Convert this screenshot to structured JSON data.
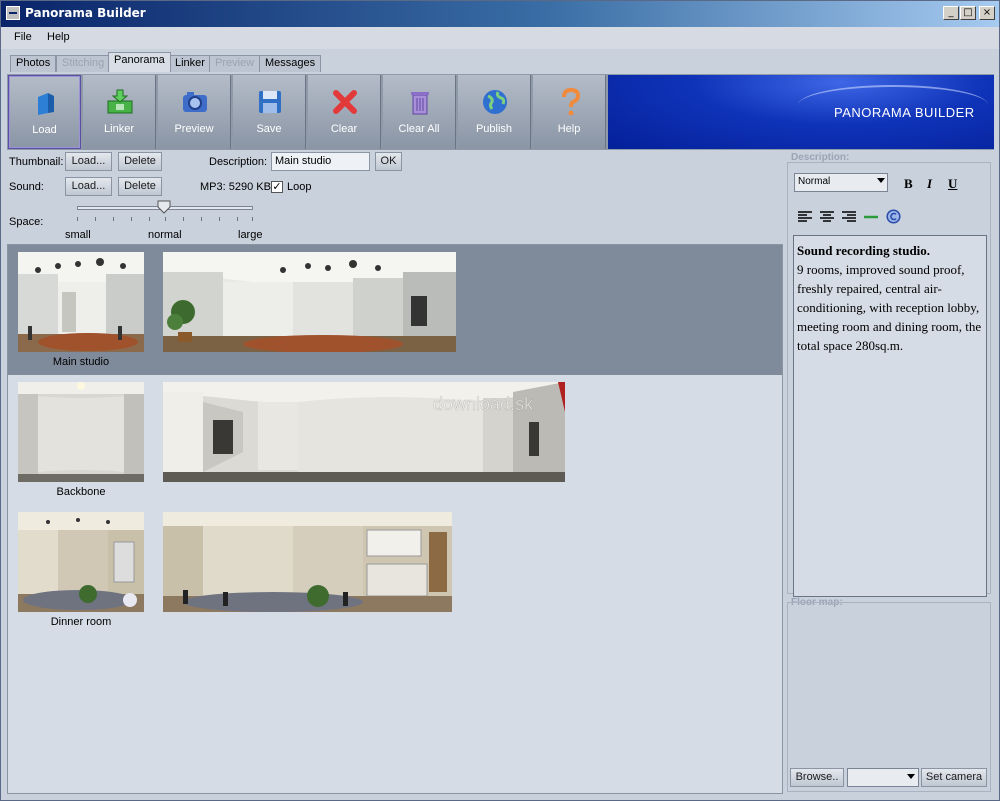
{
  "window": {
    "title": "Panorama Builder",
    "controls": {
      "minimize": "_",
      "maximize": "□",
      "close": "×"
    }
  },
  "menu": {
    "items": [
      "File",
      "Help"
    ]
  },
  "tabs": [
    {
      "label": "Photos",
      "state": "normal"
    },
    {
      "label": "Stitching",
      "state": "disabled"
    },
    {
      "label": "Panorama",
      "state": "active"
    },
    {
      "label": "Linker",
      "state": "normal"
    },
    {
      "label": "Preview",
      "state": "disabled"
    },
    {
      "label": "Messages",
      "state": "normal"
    }
  ],
  "toolbar": {
    "buttons": [
      {
        "label": "Load",
        "icon": "load-icon"
      },
      {
        "label": "Linker",
        "icon": "linker-icon"
      },
      {
        "label": "Preview",
        "icon": "camera-icon"
      },
      {
        "label": "Save",
        "icon": "save-icon"
      },
      {
        "label": "Clear",
        "icon": "clear-icon"
      },
      {
        "label": "Clear All",
        "icon": "trash-icon"
      },
      {
        "label": "Publish",
        "icon": "globe-icon"
      },
      {
        "label": "Help",
        "icon": "help-icon"
      }
    ],
    "banner_text": "PANORAMA BUILDER"
  },
  "properties": {
    "thumbnail_label": "Thumbnail:",
    "load_label": "Load...",
    "delete_label": "Delete",
    "description_label": "Description:",
    "description_value": "Main studio",
    "ok_label": "OK",
    "sound_label": "Sound:",
    "mp3_info": "MP3: 5290 KB",
    "loop_label": "Loop",
    "loop_checked": "✓",
    "space_label": "Space:",
    "space_small": "small",
    "space_normal": "normal",
    "space_large": "large"
  },
  "panoramas": [
    {
      "name": "Main studio",
      "selected": true
    },
    {
      "name": "Backbone",
      "selected": false
    },
    {
      "name": "Dinner room",
      "selected": false
    }
  ],
  "watermark": "download.sk",
  "right_panel": {
    "description_title": "Description:",
    "style_value": "Normal",
    "bold": "B",
    "italic": "I",
    "underline": "U",
    "editor_heading": "Sound recording studio.",
    "editor_body": "9 rooms, improved sound proof, freshly repaired, central air-conditioning, with reception lobby, meeting room and dining room, the total space 280sq.m.",
    "floor_title": "Floor map:",
    "browse_label": "Browse..",
    "set_camera_label": "Set camera"
  }
}
